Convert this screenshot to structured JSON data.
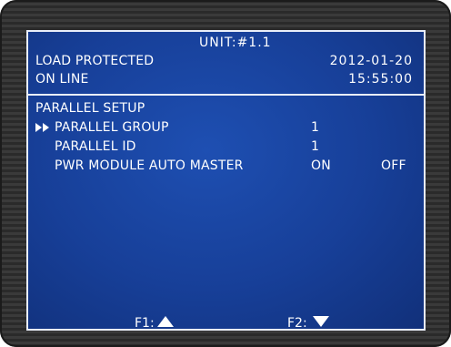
{
  "header": {
    "unit": "UNIT:#1.1",
    "status_load": "LOAD PROTECTED",
    "status_line": "ON LINE",
    "date": "2012-01-20",
    "time": "15:55:00"
  },
  "menu": {
    "section_title": "PARALLEL SETUP",
    "cursor_icon": "double-right-arrow-icon",
    "items": [
      {
        "label": "PARALLEL GROUP",
        "value": "1"
      },
      {
        "label": "PARALLEL ID",
        "value": "1"
      },
      {
        "label": "PWR MODULE AUTO MASTER",
        "option_on": "ON",
        "option_off": "OFF"
      }
    ]
  },
  "footer": {
    "f1_label": "F1:",
    "f1_icon": "up-triangle-icon",
    "f2_label": "F2:",
    "f2_icon": "down-triangle-icon"
  },
  "colors": {
    "screen_bg": "#173f98",
    "text": "#ffffff",
    "bezel": "#2a2a2a"
  }
}
